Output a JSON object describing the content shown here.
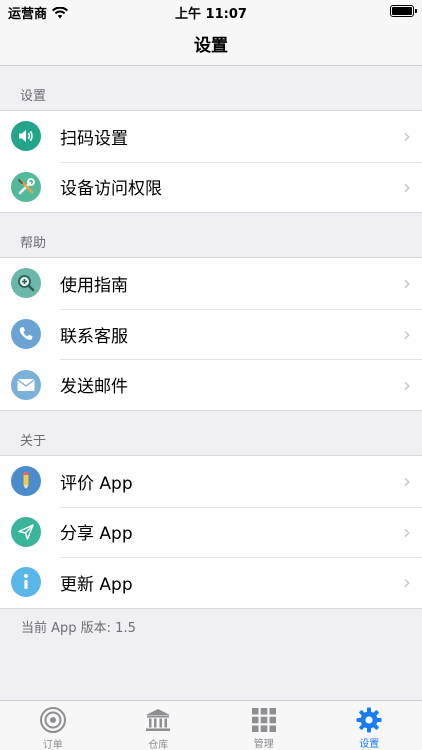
{
  "status_bar": {
    "carrier": "运营商",
    "time": "上午 11:07"
  },
  "nav": {
    "title": "设置"
  },
  "sections": [
    {
      "header": "设置",
      "items": [
        {
          "label": "扫码设置",
          "icon": "speaker-icon",
          "color": "#25a48c"
        },
        {
          "label": "设备访问权限",
          "icon": "tools-icon",
          "color": "#52b99b"
        }
      ]
    },
    {
      "header": "帮助",
      "items": [
        {
          "label": "使用指南",
          "icon": "magnifier-icon",
          "color": "#6bb7a9"
        },
        {
          "label": "联系客服",
          "icon": "phone-icon",
          "color": "#6aa3d4"
        },
        {
          "label": "发送邮件",
          "icon": "mail-icon",
          "color": "#7ab1d9"
        }
      ]
    },
    {
      "header": "关于",
      "items": [
        {
          "label": "评价 App",
          "icon": "pencil-icon",
          "color": "#4a8ccc"
        },
        {
          "label": "分享 App",
          "icon": "paper-plane-icon",
          "color": "#38b59a"
        },
        {
          "label": "更新 App",
          "icon": "info-icon",
          "color": "#5ab6e8"
        }
      ]
    }
  ],
  "version_note": "当前 App 版本: 1.5",
  "tabs": [
    {
      "label": "订单",
      "icon": "target-icon"
    },
    {
      "label": "仓库",
      "icon": "bank-icon"
    },
    {
      "label": "管理",
      "icon": "grid-icon"
    },
    {
      "label": "设置",
      "icon": "gear-icon",
      "active": true
    }
  ],
  "colors": {
    "active_tab": "#1a7cf2",
    "inactive_tab": "#8e8e93",
    "background": "#efeff4"
  }
}
